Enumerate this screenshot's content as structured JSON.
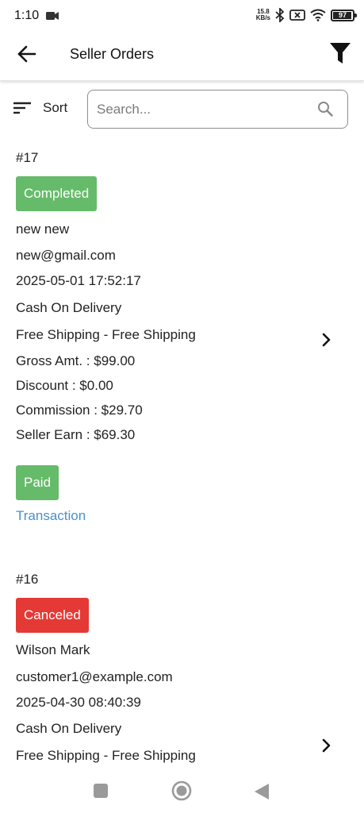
{
  "status_bar": {
    "time": "1:10",
    "speed_value": "15.8",
    "speed_unit": "KB/s",
    "battery": "97",
    "battery_level": 0.97
  },
  "app_bar": {
    "title": "Seller Orders",
    "back_icon": "arrow-back-icon",
    "filter_icon": "filter-icon"
  },
  "toolbar": {
    "sort_label": "Sort",
    "search_placeholder": "Search..."
  },
  "orders": [
    {
      "id": "#17",
      "status": "Completed",
      "status_color": "#66bb6a",
      "customer_name": "new new",
      "email": "new@gmail.com",
      "date": "2025-05-01 17:52:17",
      "payment_method": "Cash On Delivery",
      "shipping": "Free Shipping - Free Shipping",
      "gross": "Gross Amt. : $99.00",
      "discount": "Discount : $0.00",
      "commission": "Commission : $29.70",
      "seller_earn": "Seller Earn : $69.30",
      "payment_status": "Paid",
      "payment_status_color": "#66bb6a",
      "transaction_link": "Transaction"
    },
    {
      "id": "#16",
      "status": "Canceled",
      "status_color": "#e53935",
      "customer_name": "Wilson Mark",
      "email": "customer1@example.com",
      "date": "2025-04-30 08:40:39",
      "payment_method": "Cash On Delivery",
      "shipping": "Free Shipping - Free Shipping"
    }
  ],
  "nav_bar": {
    "recents_icon": "square-icon",
    "home_icon": "circle-icon",
    "back_icon": "triangle-back-icon"
  }
}
